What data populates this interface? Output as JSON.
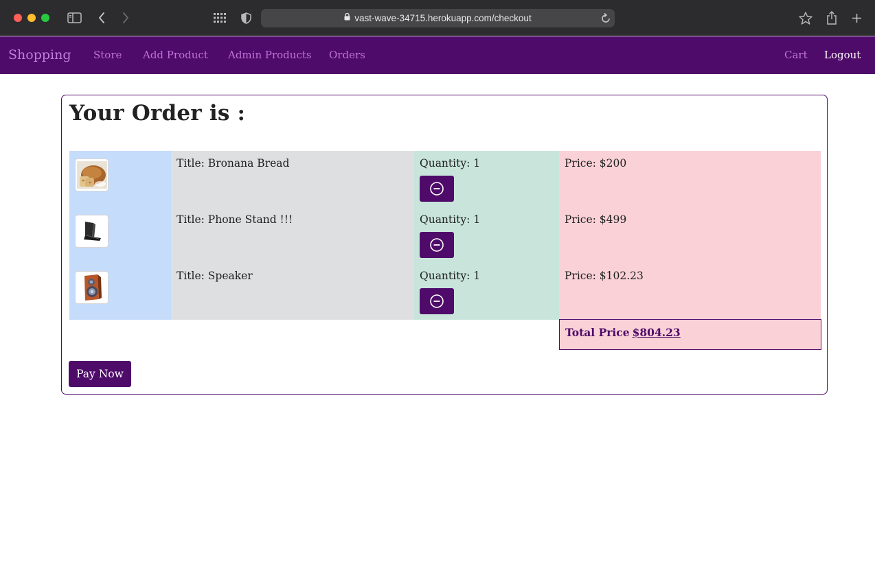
{
  "browser": {
    "url": "vast-wave-34715.herokuapp.com/checkout",
    "icons": [
      "sidebar-icon",
      "back-icon",
      "forward-icon",
      "grid-icon",
      "shield-icon",
      "lock-icon",
      "reload-icon",
      "bookmark-star-icon",
      "share-icon",
      "new-tab-icon"
    ]
  },
  "navbar": {
    "brand": "Shopping",
    "links": [
      "Store",
      "Add Product",
      "Admin Products",
      "Orders"
    ],
    "cart": "Cart",
    "logout": "Logout",
    "colors": {
      "background": "#4f0b6a",
      "link": "#c072d8",
      "logout": "#ffffff"
    }
  },
  "order": {
    "heading": "Your Order is :",
    "items": [
      {
        "image_icon": "bread-icon",
        "title": "Title: Bronana Bread",
        "quantity": "Quantity: 1",
        "price": "Price: $200"
      },
      {
        "image_icon": "phone-stand-icon",
        "title": "Title: Phone Stand !!!",
        "quantity": "Quantity: 1",
        "price": "Price: $499"
      },
      {
        "image_icon": "speaker-icon",
        "title": "Title: Speaker",
        "quantity": "Quantity: 1",
        "price": "Price: $102.23"
      }
    ],
    "total_label": "Total Price",
    "total_value": "$804.23",
    "pay_button": "Pay Now",
    "colors": {
      "image_col": "#c6dcfb",
      "title_col": "#dddfe1",
      "qty_col": "#c8e4db",
      "price_col": "#f9d1d6",
      "accent": "#4f0b6a"
    }
  }
}
